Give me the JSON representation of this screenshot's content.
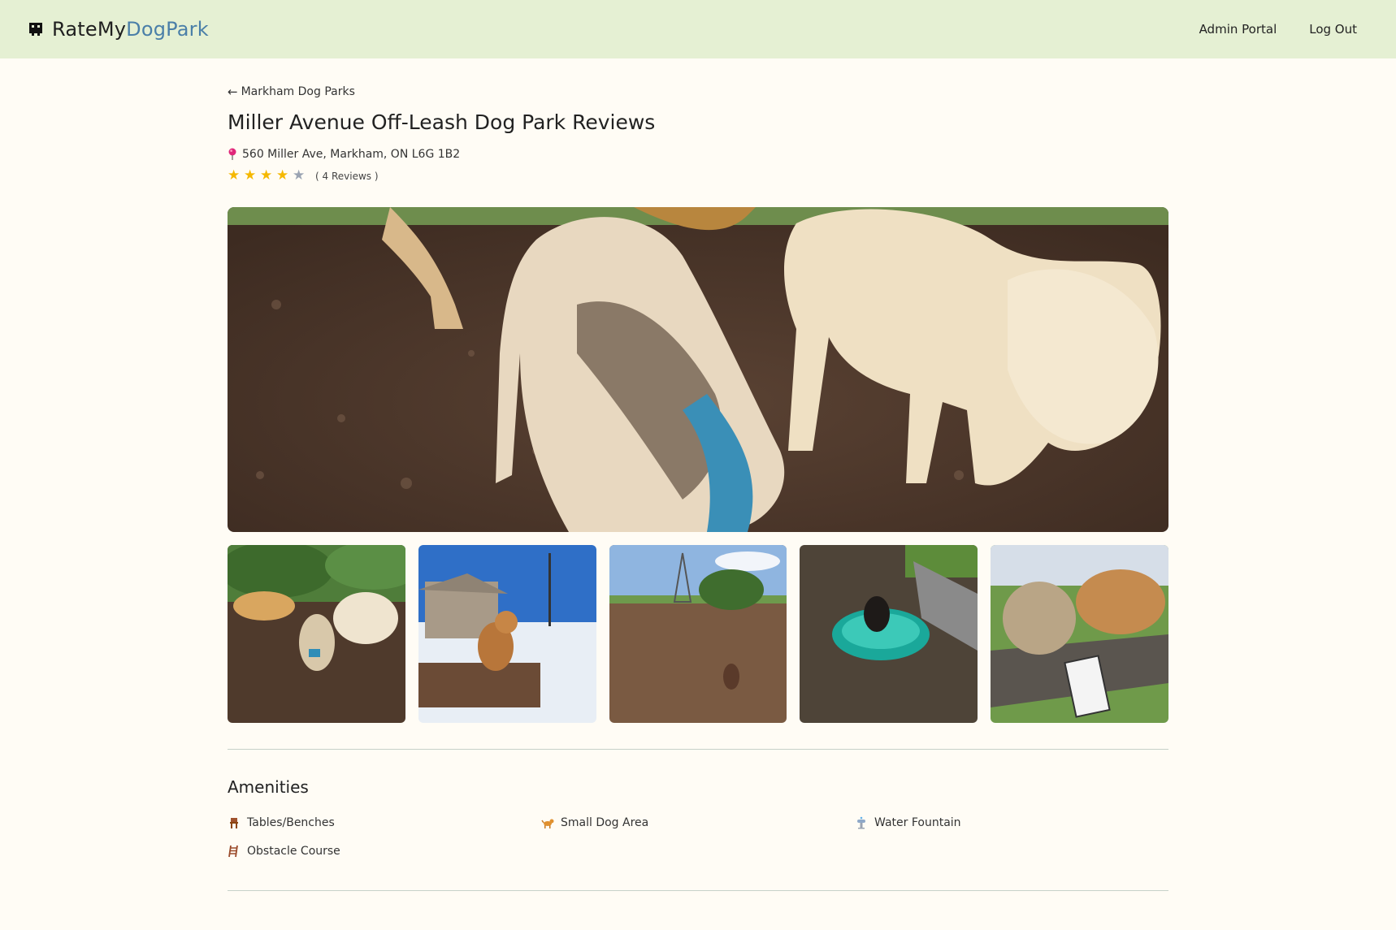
{
  "navbar": {
    "brand_main": "RateMy",
    "brand_accent": "DogPark",
    "links": [
      "Admin Portal",
      "Log Out"
    ]
  },
  "back_link": {
    "arrow": "←",
    "label": "Markham Dog Parks"
  },
  "park": {
    "title": "Miller Avenue Off-Leash Dog Park Reviews",
    "address": "560 Miller Ave, Markham, ON L6G 1B2",
    "rating": 4,
    "rating_max": 5,
    "review_count_text": "( 4 Reviews )"
  },
  "photos": {
    "hero": "photo-dogs-playing-closeup",
    "thumbnails": [
      "photo-dogs-on-mulch",
      "photo-dog-in-snow",
      "photo-park-field-towers",
      "photo-dog-in-wading-pool",
      "photo-dogs-on-obstacle-sign"
    ]
  },
  "amenities": {
    "title": "Amenities",
    "items": [
      {
        "label": "Tables/Benches",
        "icon": "bench-icon"
      },
      {
        "label": "Small Dog Area",
        "icon": "small-dog-icon"
      },
      {
        "label": "Water Fountain",
        "icon": "water-fountain-icon"
      },
      {
        "label": "Obstacle Course",
        "icon": "obstacle-course-icon"
      }
    ]
  },
  "colors": {
    "navbar_bg": "#e5f0d3",
    "page_bg": "#fffcf5",
    "brand_accent": "#4a7fa8",
    "star_filled": "#f5b800",
    "star_empty": "#9aa3b2"
  }
}
